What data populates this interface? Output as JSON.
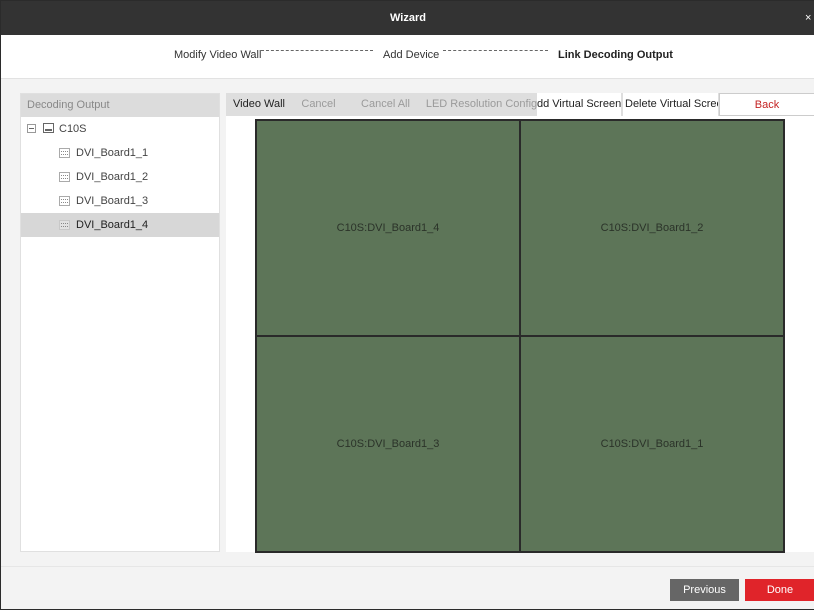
{
  "window": {
    "title": "Wizard",
    "close_glyph": "×"
  },
  "steps": [
    {
      "label": "Modify Video Wall",
      "state": "done"
    },
    {
      "label": "Add Device",
      "state": "done"
    },
    {
      "label": "Link Decoding Output",
      "state": "current"
    }
  ],
  "decoding_panel": {
    "header": "Decoding Output",
    "device": {
      "name": "C10S",
      "icon": "device-icon",
      "expanded": true
    },
    "boards": [
      {
        "label": "DVI_Board1_1",
        "selected": false
      },
      {
        "label": "DVI_Board1_2",
        "selected": false
      },
      {
        "label": "DVI_Board1_3",
        "selected": false
      },
      {
        "label": "DVI_Board1_4",
        "selected": true
      }
    ]
  },
  "toolbar": {
    "video_wall": "Video Wall",
    "cancel": "Cancel",
    "cancel_all": "Cancel All",
    "led_resolution": "LED Resolution Config",
    "add_virtual": "dd Virtual Screen",
    "delete_virtual": "Delete Virtual Scree",
    "back": "Back"
  },
  "wall": {
    "rows": 2,
    "cols": 2,
    "cells": [
      {
        "label": "C10S:DVI_Board1_4"
      },
      {
        "label": "C10S:DVI_Board1_2"
      },
      {
        "label": "C10S:DVI_Board1_3"
      },
      {
        "label": "C10S:DVI_Board1_1"
      }
    ]
  },
  "footer": {
    "previous": "Previous",
    "done": "Done"
  },
  "colors": {
    "titlebar": "#333333",
    "cell_fill": "#5d7558",
    "done_button": "#e0242a",
    "previous_button": "#666666",
    "back_text": "#c42323"
  }
}
